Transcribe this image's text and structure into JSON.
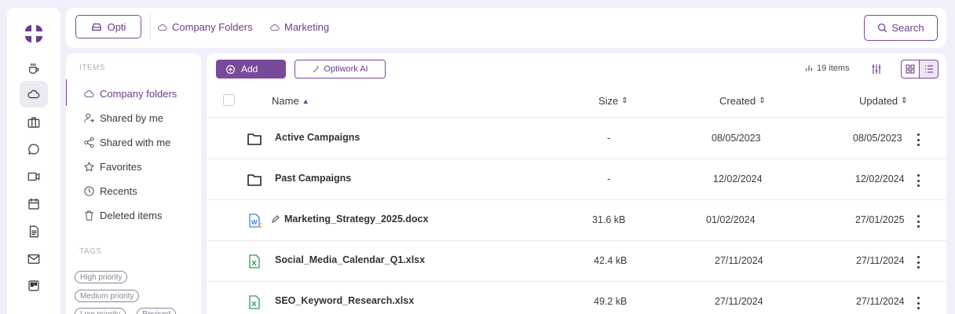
{
  "topbar": {
    "opti_label": "Opti",
    "breadcrumb": [
      "Company Folders",
      "Marketing"
    ],
    "search_label": "Search"
  },
  "side": {
    "items_heading": "ITEMS",
    "items": [
      {
        "label": "Company folders",
        "icon": "cloud-icon"
      },
      {
        "label": "Shared by me",
        "icon": "shared-by-me-icon"
      },
      {
        "label": "Shared with me",
        "icon": "share-icon"
      },
      {
        "label": "Favorites",
        "icon": "star-icon"
      },
      {
        "label": "Recents",
        "icon": "clock-icon"
      },
      {
        "label": "Deleted items",
        "icon": "trash-icon"
      }
    ],
    "tags_heading": "TAGS",
    "tags": [
      "High priority",
      "Medium priority",
      "Low priority",
      "Revised"
    ]
  },
  "toolbar": {
    "add_label": "Add",
    "ai_label": "Optiwork AI",
    "count_label": "19 items"
  },
  "table": {
    "columns": {
      "name": "Name",
      "size": "Size",
      "created": "Created",
      "updated": "Updated"
    },
    "rows": [
      {
        "name": "Active Campaigns",
        "type": "folder",
        "size": "-",
        "created": "08/05/2023",
        "updated": "08/05/2023"
      },
      {
        "name": "Past Campaigns",
        "type": "folder",
        "size": "-",
        "created": "12/02/2024",
        "updated": "12/02/2024"
      },
      {
        "name": "Marketing_Strategy_2025.docx",
        "type": "word",
        "size": "31.6 kB",
        "created": "01/02/2024",
        "updated": "27/01/2025"
      },
      {
        "name": "Social_Media_Calendar_Q1.xlsx",
        "type": "excel",
        "size": "42.4 kB",
        "created": "27/11/2024",
        "updated": "27/11/2024"
      },
      {
        "name": "SEO_Keyword_Research.xlsx",
        "type": "excel",
        "size": "49.2 kB",
        "created": "27/11/2024",
        "updated": "27/11/2024"
      }
    ]
  },
  "colors": {
    "accent": "#7a4a9a",
    "background": "#f1effa",
    "word": "#4a7fd6",
    "excel": "#2e9a5a"
  }
}
